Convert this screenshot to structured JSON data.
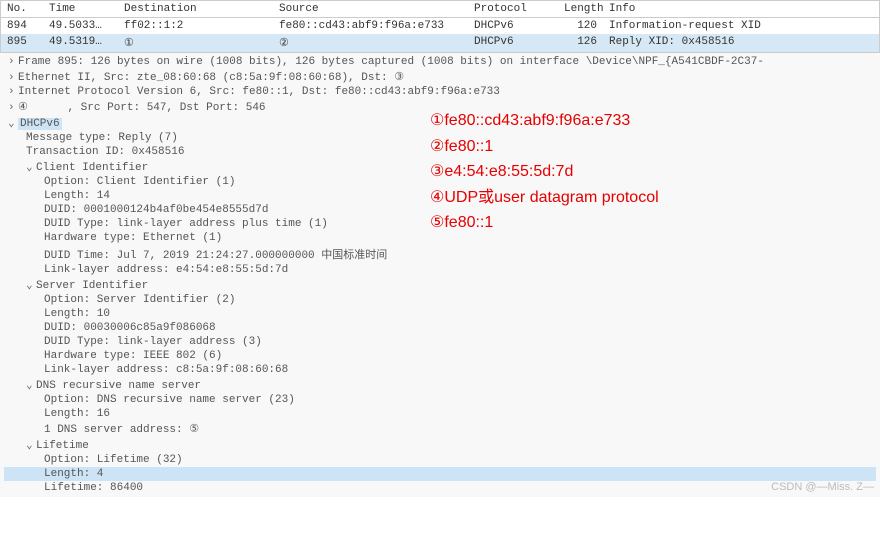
{
  "columns": {
    "no": "No.",
    "time": "Time",
    "dest": "Destination",
    "src": "Source",
    "proto": "Protocol",
    "len": "Length",
    "info": "Info"
  },
  "packets": [
    {
      "no": "894",
      "time": "49.5033…",
      "dest": "ff02::1:2",
      "src": "fe80::cd43:abf9:f96a:e733",
      "proto": "DHCPv6",
      "len": "120",
      "info": "Information-request XID"
    },
    {
      "no": "895",
      "time": "49.5319…",
      "dest": "①",
      "src": "②",
      "proto": "DHCPv6",
      "len": "126",
      "info": "Reply XID: 0x458516"
    }
  ],
  "details": {
    "frame": "Frame 895: 126 bytes on wire (1008 bits), 126 bytes captured (1008 bits) on interface \\Device\\NPF_{A541CBDF-2C37-",
    "eth": "Ethernet II, Src: zte_08:60:68 (c8:5a:9f:08:60:68), Dst:  ③",
    "ipv6": "Internet Protocol Version 6, Src: fe80::1, Dst: fe80::cd43:abf9:f96a:e733",
    "udp_prefix": "④",
    "udp_rest": ", Src Port: 547, Dst Port: 546",
    "dhcp_label": "DHCPv6",
    "msg_type": "Message type: Reply (7)",
    "txid": "Transaction ID: 0x458516",
    "client_id_header": "Client Identifier",
    "client_id": {
      "option": "Option: Client Identifier (1)",
      "length": "Length: 14",
      "duid": "DUID: 0001000124b4af0be454e8555d7d",
      "duid_type": "DUID Type: link-layer address plus time (1)",
      "hw_type": "Hardware type: Ethernet (1)",
      "duid_time": "DUID Time: Jul  7, 2019 21:24:27.000000000 中国标准时间",
      "ll_addr": "Link-layer address: e4:54:e8:55:5d:7d"
    },
    "server_id_header": "Server Identifier",
    "server_id": {
      "option": "Option: Server Identifier (2)",
      "length": "Length: 10",
      "duid": "DUID: 00030006c85a9f086068",
      "duid_type": "DUID Type: link-layer address (3)",
      "hw_type": "Hardware type: IEEE 802 (6)",
      "ll_addr": "Link-layer address: c8:5a:9f:08:60:68"
    },
    "dns_header": "DNS recursive name server",
    "dns": {
      "option": "Option: DNS recursive name server (23)",
      "length": "Length: 16",
      "addr": "1 DNS server address:  ⑤"
    },
    "lifetime_header": "Lifetime",
    "lifetime": {
      "option": "Option: Lifetime (32)",
      "length": "Length: 4",
      "value": "Lifetime: 86400"
    }
  },
  "annotations": [
    "①fe80::cd43:abf9:f96a:e733",
    "②fe80::1",
    "③e4:54:e8:55:5d:7d",
    "④UDP或user datagram protocol",
    "⑤fe80::1"
  ],
  "watermark": "CSDN @—Miss. Z—"
}
